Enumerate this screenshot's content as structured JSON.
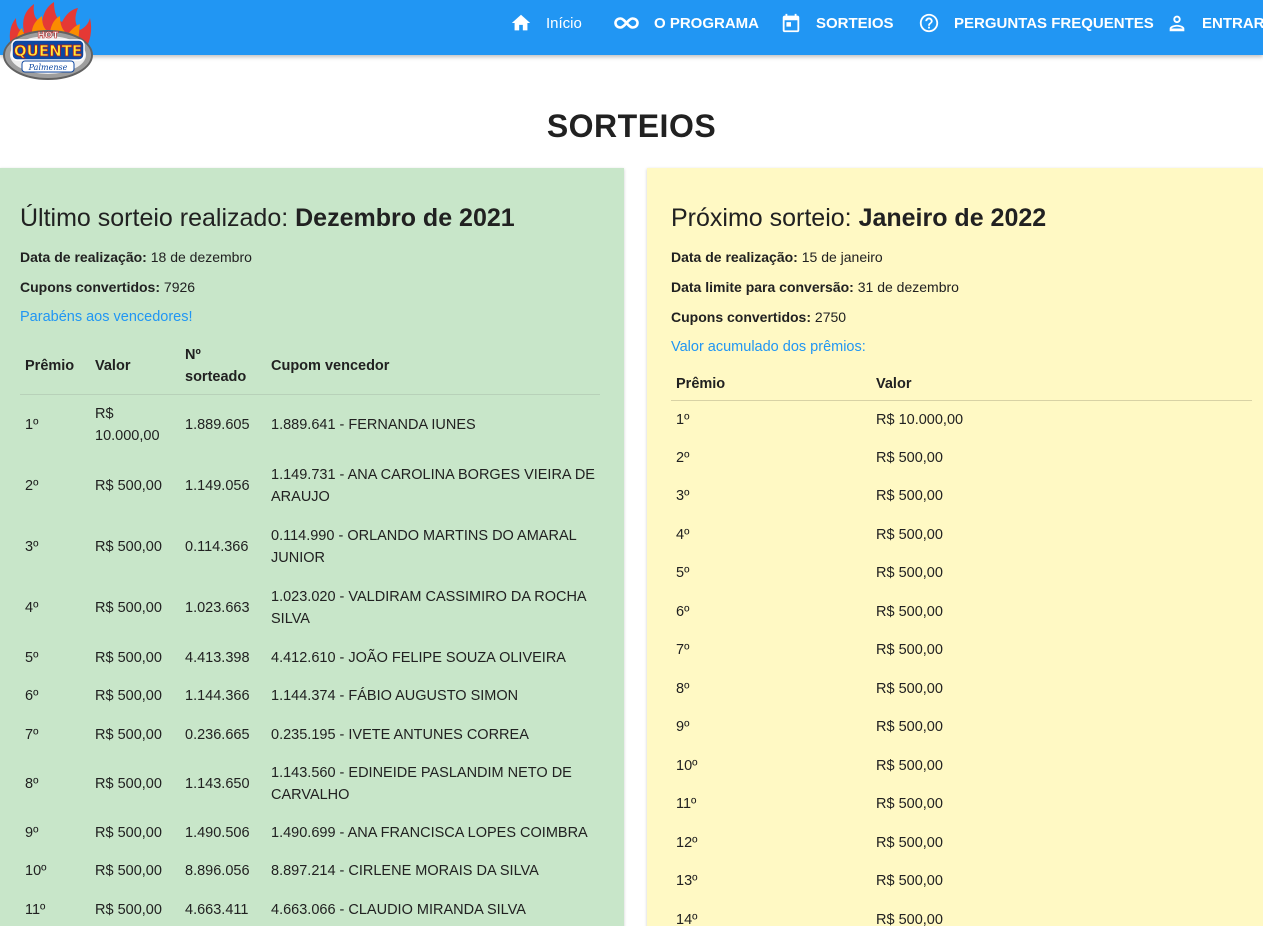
{
  "logo": {
    "text": "HOT QUENTE Palmense",
    "top_text": "HOT",
    "main_text": "QUENTE",
    "script_text": "Palmense"
  },
  "nav": [
    {
      "label": "Início",
      "icon": "home-icon"
    },
    {
      "label": "O PROGRAMA",
      "icon": "infinity-icon"
    },
    {
      "label": "SORTEIOS",
      "icon": "calendar-icon"
    },
    {
      "label": "PERGUNTAS FREQUENTES",
      "icon": "help-circle-icon"
    },
    {
      "label": "ENTRAR",
      "icon": "person-icon"
    }
  ],
  "page": {
    "title": "SORTEIOS"
  },
  "last_draw": {
    "heading_prefix": "Último sorteio realizado: ",
    "heading_month": "Dezembro de 2021",
    "date_label": "Data de realização:",
    "date_value": " 18 de dezembro",
    "coupons_label": "Cupons convertidos:",
    "coupons_value": " 7926",
    "congrats": "Parabéns aos vencedores!",
    "columns": [
      "Prêmio",
      "Valor",
      "Nº sorteado",
      "Cupom vencedor"
    ],
    "rows": [
      {
        "prize": "1º",
        "value": "R$ 10.000,00",
        "number": "1.889.605",
        "coupon": "1.889.641 - FERNANDA IUNES"
      },
      {
        "prize": "2º",
        "value": "R$ 500,00",
        "number": "1.149.056",
        "coupon": "1.149.731 - ANA CAROLINA BORGES VIEIRA DE ARAUJO"
      },
      {
        "prize": "3º",
        "value": "R$ 500,00",
        "number": "0.114.366",
        "coupon": "0.114.990 - ORLANDO MARTINS DO AMARAL JUNIOR"
      },
      {
        "prize": "4º",
        "value": "R$ 500,00",
        "number": "1.023.663",
        "coupon": "1.023.020 - VALDIRAM CASSIMIRO DA ROCHA SILVA"
      },
      {
        "prize": "5º",
        "value": "R$ 500,00",
        "number": "4.413.398",
        "coupon": "4.412.610 - JOÃO FELIPE SOUZA OLIVEIRA"
      },
      {
        "prize": "6º",
        "value": "R$ 500,00",
        "number": "1.144.366",
        "coupon": "1.144.374 - FÁBIO AUGUSTO SIMON"
      },
      {
        "prize": "7º",
        "value": "R$ 500,00",
        "number": "0.236.665",
        "coupon": "0.235.195 - IVETE ANTUNES CORREA"
      },
      {
        "prize": "8º",
        "value": "R$ 500,00",
        "number": "1.143.650",
        "coupon": "1.143.560 - EDINEIDE PASLANDIM NETO DE CARVALHO"
      },
      {
        "prize": "9º",
        "value": "R$ 500,00",
        "number": "1.490.506",
        "coupon": "1.490.699 - ANA FRANCISCA LOPES COIMBRA"
      },
      {
        "prize": "10º",
        "value": "R$ 500,00",
        "number": "8.896.056",
        "coupon": "8.897.214 - CIRLENE MORAIS DA SILVA"
      },
      {
        "prize": "11º",
        "value": "R$ 500,00",
        "number": "4.663.411",
        "coupon": "4.663.066 - CLAUDIO MIRANDA SILVA"
      }
    ]
  },
  "next_draw": {
    "heading_prefix": "Próximo sorteio: ",
    "heading_month": "Janeiro de 2022",
    "date_label": "Data de realização:",
    "date_value": " 15 de janeiro",
    "deadline_label": "Data limite para conversão:",
    "deadline_value": " 31 de dezembro",
    "coupons_label": "Cupons convertidos:",
    "coupons_value": " 2750",
    "accumulated": "Valor acumulado dos prêmios:",
    "columns": [
      "Prêmio",
      "Valor"
    ],
    "rows": [
      {
        "prize": "1º",
        "value": "R$ 10.000,00"
      },
      {
        "prize": "2º",
        "value": "R$ 500,00"
      },
      {
        "prize": "3º",
        "value": "R$ 500,00"
      },
      {
        "prize": "4º",
        "value": "R$ 500,00"
      },
      {
        "prize": "5º",
        "value": "R$ 500,00"
      },
      {
        "prize": "6º",
        "value": "R$ 500,00"
      },
      {
        "prize": "7º",
        "value": "R$ 500,00"
      },
      {
        "prize": "8º",
        "value": "R$ 500,00"
      },
      {
        "prize": "9º",
        "value": "R$ 500,00"
      },
      {
        "prize": "10º",
        "value": "R$ 500,00"
      },
      {
        "prize": "11º",
        "value": "R$ 500,00"
      },
      {
        "prize": "12º",
        "value": "R$ 500,00"
      },
      {
        "prize": "13º",
        "value": "R$ 500,00"
      },
      {
        "prize": "14º",
        "value": "R$ 500,00"
      }
    ]
  },
  "colors": {
    "appbar": "#2196f3",
    "left_panel": "#c8e6c9",
    "right_panel": "#fff9c4",
    "link": "#2196f3"
  }
}
